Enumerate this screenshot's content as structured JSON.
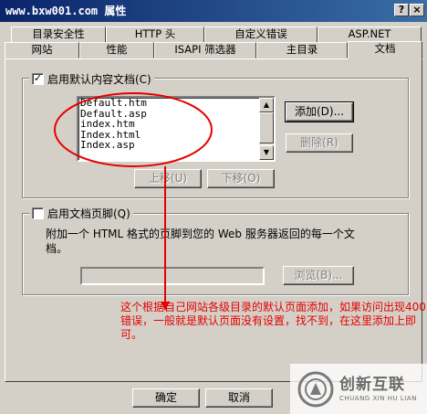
{
  "window": {
    "title": "www.bxw001.com 属性",
    "help_button": "?",
    "close_button": "×"
  },
  "tabs": {
    "row1": [
      "目录安全性",
      "HTTP 头",
      "自定义错误",
      "ASP.NET"
    ],
    "row2": [
      "网站",
      "性能",
      "ISAPI 筛选器",
      "主目录",
      "文档"
    ],
    "active": "文档"
  },
  "default_doc": {
    "checkbox_label": "启用默认内容文档(C)",
    "checked": true,
    "check_mark": "✓",
    "documents": [
      "Default.htm",
      "Default.asp",
      "index.htm",
      "Index.html",
      "Index.asp"
    ],
    "add_button": "添加(D)...",
    "remove_button": "删除(R)",
    "move_up_button": "上移(U)",
    "move_down_button": "下移(O)",
    "scroll_up": "▲",
    "scroll_down": "▼"
  },
  "footer_doc": {
    "checkbox_label": "启用文档页脚(Q)",
    "checked": false,
    "description": "附加一个 HTML 格式的页脚到您的 Web 服务器返回的每一个文档。",
    "browse_button": "浏览(B)..."
  },
  "annotation": {
    "text": "这个根据自己网站各级目录的默认页面添加，如果访问出现400错误，一般就是默认页面没有设置，找不到，在这里添加上即可。",
    "color": "#e60000"
  },
  "dialog_buttons": {
    "ok": "确定",
    "cancel": "取消"
  },
  "watermark": {
    "cn": "创新互联",
    "en": "CHUANG XIN HU LIAN"
  }
}
